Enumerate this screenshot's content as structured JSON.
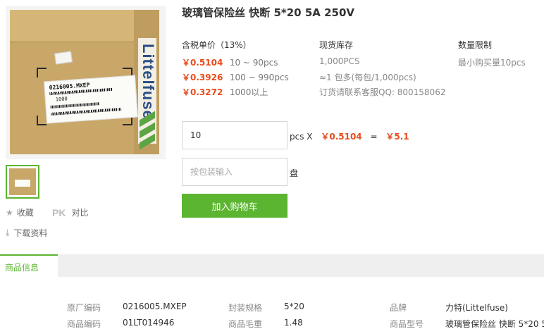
{
  "product": {
    "title": "玻璃管保险丝 快断 5*20 5A 250V",
    "image_label": {
      "code": "0216005.MXEP",
      "qty": "1000",
      "brand": "Littelfuse"
    }
  },
  "actions": {
    "favorite": "收藏",
    "compare_prefix": "PK",
    "compare": "对比",
    "download": "下载资料"
  },
  "pricing": {
    "header": "含税单价（13%）",
    "tiers": [
      {
        "price": "￥0.5104",
        "range": "10 ~ 90pcs"
      },
      {
        "price": "￥0.3926",
        "range": "100 ~ 990pcs"
      },
      {
        "price": "￥0.3272",
        "range": "1000以上"
      }
    ]
  },
  "stock": {
    "header": "现货库存",
    "lines": [
      "1,000PCS",
      "≈1 包多(每包/1,000pcs)",
      "订货请联系客服QQ: 800158062"
    ]
  },
  "limit": {
    "header": "数量限制",
    "text": "最小购买量10pcs"
  },
  "quantity": {
    "value": "10",
    "unit": "pcs X",
    "unit_price": "￥0.5104",
    "equals": "=",
    "total": "￥5.1"
  },
  "package": {
    "placeholder": "按包装输入",
    "unit": "盘"
  },
  "cart_button": "加入购物车",
  "tabs": {
    "active": "商品信息"
  },
  "specs": {
    "rows": [
      [
        {
          "label": "原厂编码",
          "value": "0216005.MXEP"
        },
        {
          "label": "封装规格",
          "value": "5*20"
        },
        {
          "label": "品牌",
          "value": "力特(Littelfuse)"
        }
      ],
      [
        {
          "label": "商品编码",
          "value": "01LT014946"
        },
        {
          "label": "商品毛重",
          "value": "1.48"
        },
        {
          "label": "商品型号",
          "value": "玻璃管保险丝 快断 5*20 5..."
        }
      ]
    ]
  },
  "colors": {
    "accent": "#5cb531",
    "price": "#e74c1c"
  }
}
